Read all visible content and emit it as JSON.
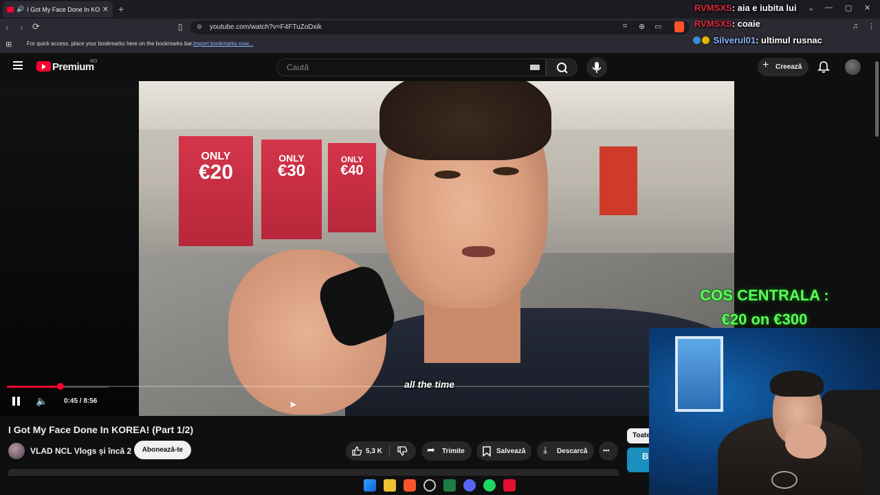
{
  "browser": {
    "tab_title": "I Got My Face Done In KOREA!",
    "tab_close": "✕",
    "new_tab": "+",
    "url": "youtube.com/watch?v=F4FTuZoDxik",
    "bookmarks_hint": "For quick access, place your bookmarks here on the bookmarks bar.",
    "bookmarks_import": "Import bookmarks now...",
    "window_controls": [
      "⌄",
      "—",
      "▢",
      "✕"
    ]
  },
  "chat": [
    {
      "user": "RVMSXS",
      "message": ": aia e iubita lui",
      "color": "#e0293a"
    },
    {
      "user": "RVMSXS",
      "message": ": coaie",
      "color": "#e0293a"
    },
    {
      "user": "Silverul01",
      "message": ": ultimul rusnac",
      "color": "#8ab4ff"
    }
  ],
  "youtube": {
    "logo": "Premium",
    "logo_region": "RO",
    "search_placeholder": "Caută",
    "create_label": "Creează",
    "icons": [
      "menu-icon",
      "search-icon",
      "mic-icon",
      "plus-icon",
      "bell-icon"
    ]
  },
  "player": {
    "subtitle": "all the time",
    "time": "0:45 / 8:56",
    "progress": 0.084,
    "overlay_line1": "COS CENTRALA :",
    "overlay_line2": "€20 on €300",
    "posters": [
      {
        "top": "ONLY",
        "price": "€20"
      },
      {
        "top": "ONLY",
        "price": "€30"
      },
      {
        "top": "ONLY",
        "price": "€40"
      }
    ]
  },
  "video": {
    "title": "I Got My Face Done In KOREA! (Part 1/2)",
    "channel": "VLAD NCL Vlogs și încă 2",
    "subscribe": "Abonează-te",
    "likes": "5,3 K",
    "share": "Trimite",
    "save": "Salvează",
    "download": "Descarcă",
    "more": "•••",
    "filter_chip": "Toate",
    "side_letter": "B"
  }
}
